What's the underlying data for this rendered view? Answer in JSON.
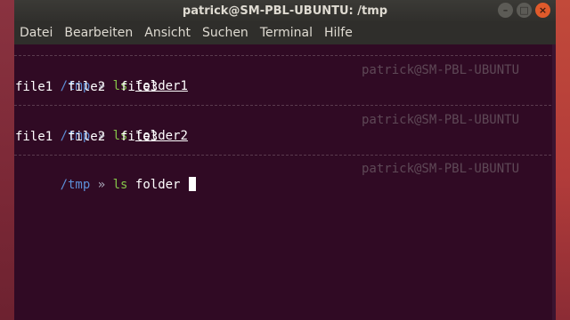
{
  "window": {
    "title": "patrick@SM-PBL-UBUNTU: /tmp",
    "controls": {
      "minimize": "–",
      "maximize": "□",
      "close": "×"
    }
  },
  "menubar": {
    "items": [
      "Datei",
      "Bearbeiten",
      "Ansicht",
      "Suchen",
      "Terminal",
      "Hilfe"
    ]
  },
  "terminal": {
    "host_hint": "patrick@SM-PBL-UBUNTU",
    "prompt_dir": "/tmp",
    "prompt_arrow": "»",
    "blocks": [
      {
        "command": "ls",
        "argument": "folder1",
        "output": "file1  file2  file3"
      },
      {
        "command": "ls",
        "argument": "folder2",
        "output": "file1  file2  file3"
      },
      {
        "command": "ls",
        "argument": "folder",
        "output": ""
      }
    ]
  },
  "colors": {
    "terminal_bg": "#300a24",
    "prompt_dir": "#5c8ed6",
    "command": "#84c449",
    "close_button": "#e05a2b"
  }
}
